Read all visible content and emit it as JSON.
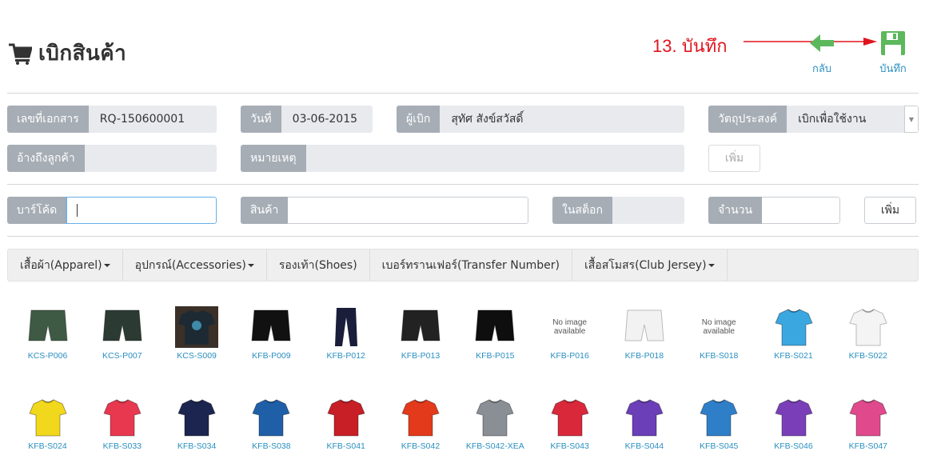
{
  "page": {
    "title": "เบิกสินค้า"
  },
  "annotation": {
    "text": "13. บันทึก",
    "color": "#e0141e"
  },
  "header_buttons": {
    "back_label": "กลับ",
    "save_label": "บันทึก"
  },
  "form": {
    "doc_no": {
      "label": "เลขที่เอกสาร",
      "value": "RQ-150600001"
    },
    "date": {
      "label": "วันที่",
      "value": "03-06-2015"
    },
    "requester": {
      "label": "ผู้เบิก",
      "value": "สุทัศ สังข์สวัสดิ์"
    },
    "purpose": {
      "label": "วัตถุประสงค์",
      "value": "เบิกเพื่อใช้งาน"
    },
    "customer_ref": {
      "label": "อ้างถึงลูกค้า",
      "value": ""
    },
    "note": {
      "label": "หมายเหตุ",
      "value": ""
    },
    "add_label_top": "เพิ่ม"
  },
  "entry": {
    "barcode": {
      "label": "บาร์โค้ด",
      "value": ""
    },
    "product": {
      "label": "สินค้า",
      "value": ""
    },
    "in_stock": {
      "label": "ในสต็อก",
      "value": ""
    },
    "quantity": {
      "label": "จำนวน",
      "value": ""
    },
    "add_label": "เพิ่ม"
  },
  "categories": [
    {
      "label": "เสื้อผ้า(Apparel)",
      "dropdown": true
    },
    {
      "label": "อุปกรณ์(Accessories)",
      "dropdown": true
    },
    {
      "label": "รองเท้า(Shoes)",
      "dropdown": false
    },
    {
      "label": "เบอร์ทรานเฟอร์(Transfer Number)",
      "dropdown": false
    },
    {
      "label": "เสื้อสโมสร(Club Jersey)",
      "dropdown": true
    }
  ],
  "no_image_text": [
    "No image",
    "available"
  ],
  "products_row1": [
    {
      "code": "KCS-P006",
      "kind": "shorts",
      "color": "#3e5a45"
    },
    {
      "code": "KCS-P007",
      "kind": "shorts",
      "color": "#2b3b33"
    },
    {
      "code": "KCS-S009",
      "kind": "tee",
      "color": "#1d2a33"
    },
    {
      "code": "KFB-P009",
      "kind": "shorts",
      "color": "#111111"
    },
    {
      "code": "KFB-P012",
      "kind": "pants",
      "color": "#1a1e3a"
    },
    {
      "code": "KFB-P013",
      "kind": "shorts",
      "color": "#222222"
    },
    {
      "code": "KFB-P015",
      "kind": "shorts",
      "color": "#0e0e0e"
    },
    {
      "code": "KFB-P016",
      "kind": "noimage",
      "color": ""
    },
    {
      "code": "KFB-P018",
      "kind": "shorts",
      "color": "#f2f2f2"
    },
    {
      "code": "KFB-S018",
      "kind": "noimage",
      "color": ""
    },
    {
      "code": "KFB-S021",
      "kind": "jersey",
      "color": "#3aa7e0"
    },
    {
      "code": "KFB-S022",
      "kind": "jersey",
      "color": "#f4f4f4"
    }
  ],
  "products_row2": [
    {
      "code": "KFB-S024",
      "kind": "jersey",
      "color": "#f2d81c"
    },
    {
      "code": "KFB-S033",
      "kind": "jersey",
      "color": "#e8384f"
    },
    {
      "code": "KFB-S034",
      "kind": "jersey",
      "color": "#1c2550"
    },
    {
      "code": "KFB-S038",
      "kind": "jersey",
      "color": "#1f5fa8"
    },
    {
      "code": "KFB-S041",
      "kind": "jersey",
      "color": "#c81e26"
    },
    {
      "code": "KFB-S042",
      "kind": "jersey",
      "color": "#e33a1b"
    },
    {
      "code": "KFB-S042-XEA",
      "kind": "jersey",
      "color": "#8a8f95"
    },
    {
      "code": "KFB-S043",
      "kind": "jersey",
      "color": "#d9283a"
    },
    {
      "code": "KFB-S044",
      "kind": "jersey",
      "color": "#6a3fb8"
    },
    {
      "code": "KFB-S045",
      "kind": "jersey",
      "color": "#2f7fc8"
    },
    {
      "code": "KFB-S046",
      "kind": "jersey",
      "color": "#7a3fb8"
    },
    {
      "code": "KFB-S047",
      "kind": "jersey",
      "color": "#e04a8c"
    }
  ],
  "colors": {
    "addon": "#a6adb5",
    "field": "#e8eaee",
    "link": "#2a8fbf",
    "save_green": "#5cb85c"
  }
}
